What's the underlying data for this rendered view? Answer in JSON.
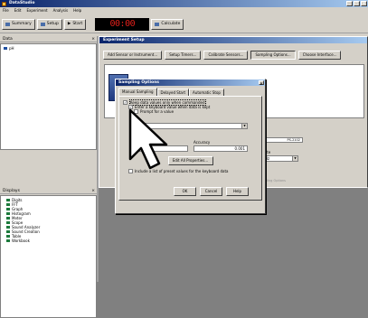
{
  "app": {
    "title": "DataStudio"
  },
  "menu": [
    "File",
    "Edit",
    "Experiment",
    "Analysis",
    "Help"
  ],
  "toolbar": {
    "summary": "Summary",
    "setup": "Setup",
    "start": "Start",
    "timer": "00:00",
    "calculate": "Calculate"
  },
  "data_panel": {
    "title": "Data",
    "items": [
      "pH"
    ]
  },
  "displays_panel": {
    "title": "Displays",
    "items": [
      "Digits",
      "FFT",
      "Graph",
      "Histogram",
      "Meter",
      "Scope",
      "Sound Analyzer",
      "Sound Creation",
      "Table",
      "Workbook"
    ]
  },
  "setup_window": {
    "title": "Experiment Setup",
    "buttons": [
      "Add Sensor or Instrument...",
      "Setup Timers...",
      "Calibrate Sensors...",
      "Sampling Options...",
      "Choose Interface..."
    ],
    "channel_value": "PS-2102",
    "rate_label": "Rate",
    "rate_value": "Hz",
    "sampling_options_label": "Sampling Options"
  },
  "dialog": {
    "title": "Sampling Options",
    "tabs": [
      "Manual Sampling",
      "Delayed Start",
      "Automatic Stop"
    ],
    "keep_values": "Keep data values only when commanded",
    "enter_keyboard": "Enter a keyboard value when data is kept",
    "prompt": "Prompt for a value",
    "units_label": "Units",
    "units_value": "no units",
    "accuracy_label": "Accuracy",
    "accuracy_value": "0.001",
    "edit_button": "Edit All Properties...",
    "include_list": "Include a list of preset values for the keyboard data",
    "ok": "OK",
    "cancel": "Cancel",
    "help": "Help"
  }
}
